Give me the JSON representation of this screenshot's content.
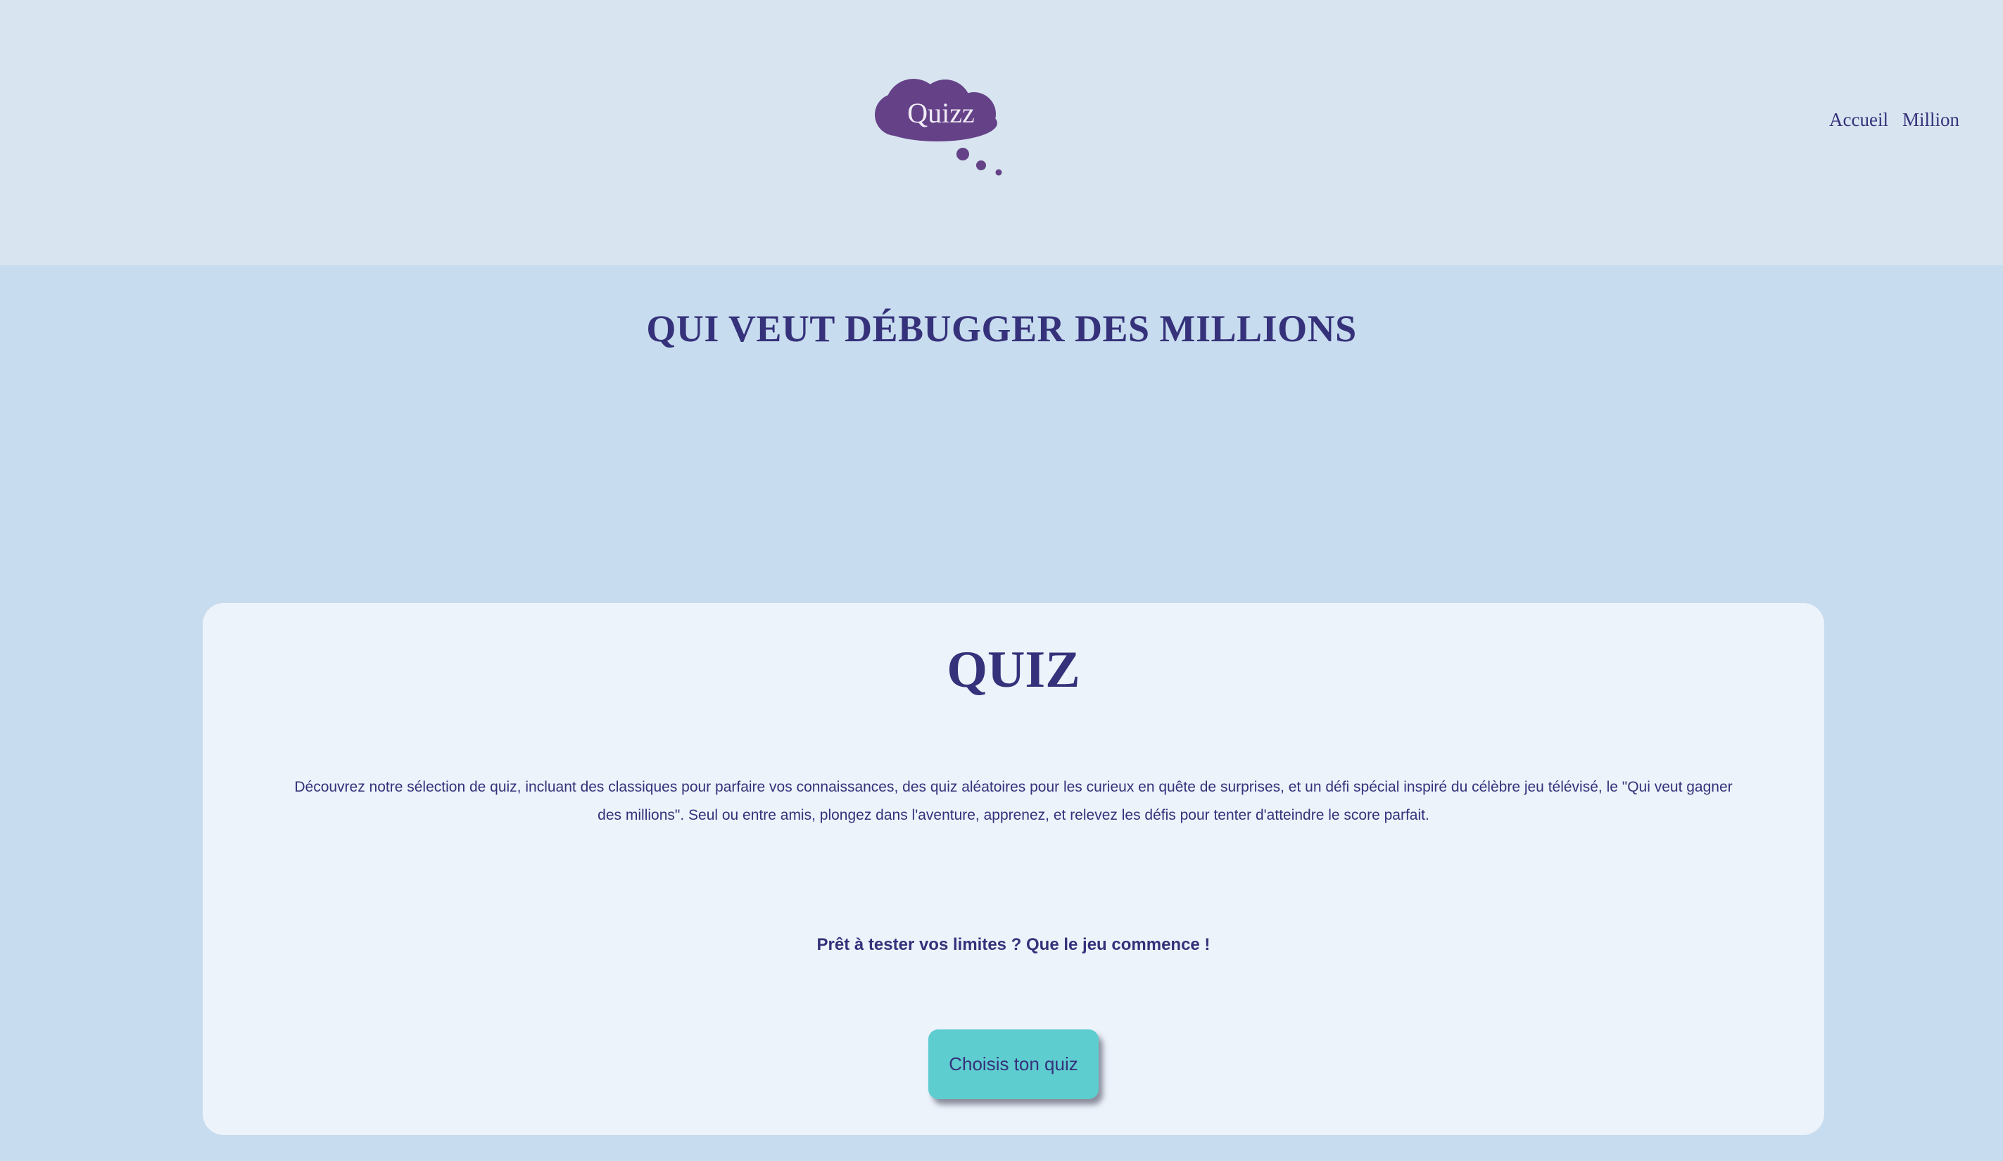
{
  "header": {
    "logo_text": "Quizz",
    "nav": [
      {
        "label": "Accueil"
      },
      {
        "label": "Million"
      }
    ]
  },
  "hero": {
    "title": "QUI VEUT DÉBUGGER DES MILLIONS"
  },
  "card": {
    "title": "QUIZ",
    "description": "Découvrez notre sélection de quiz, incluant des classiques pour parfaire vos connaissances, des quiz aléatoires pour les curieux en quête de surprises, et un défi spécial inspiré du célèbre jeu télévisé, le \"Qui veut gagner des millions\". Seul ou entre amis, plongez dans l'aventure, apprenez, et relevez les défis pour tenter d'atteindre le score parfait.",
    "cta": "Prêt à tester vos limites ? Que le jeu commence !",
    "button_label": "Choisis ton quiz"
  },
  "colors": {
    "header_bg": "#d8e5f1",
    "page_bg": "#c7dcee",
    "card_bg": "#edf3fb",
    "text": "#35317a",
    "logo": "#654287",
    "button": "#5ecdd0"
  }
}
